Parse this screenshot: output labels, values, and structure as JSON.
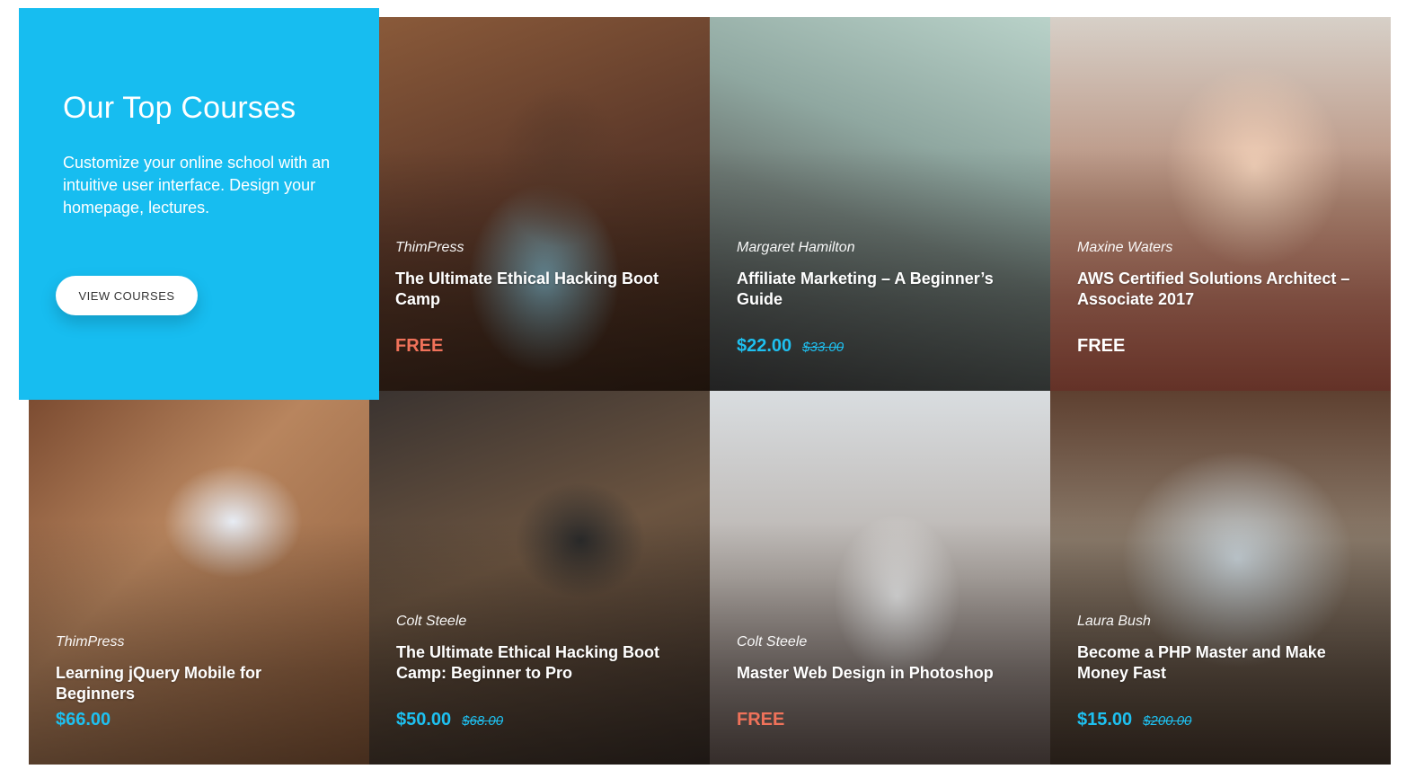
{
  "hero": {
    "title": "Our Top Courses",
    "description": "Customize your online school with an intuitive user interface. Design your homepage, lectures.",
    "button_label": "VIEW COURSES"
  },
  "courses": [
    {
      "author": "ThimPress",
      "title": "The Ultimate Ethical Hacking Boot Camp",
      "price": "FREE",
      "old_price": ""
    },
    {
      "author": "Margaret Hamilton",
      "title": "Affiliate Marketing – A Beginner’s Guide",
      "price": "$22.00",
      "old_price": "$33.00"
    },
    {
      "author": "Maxine Waters",
      "title": "AWS Certified Solutions Architect – Associate 2017",
      "price": "FREE",
      "old_price": ""
    },
    {
      "author": "ThimPress",
      "title": "Learning jQuery Mobile for Beginners",
      "price": "$66.00",
      "old_price": ""
    },
    {
      "author": "Colt Steele",
      "title": "The Ultimate Ethical Hacking Boot Camp: Beginner to Pro",
      "price": "$50.00",
      "old_price": "$68.00"
    },
    {
      "author": "Colt Steele",
      "title": "Master Web Design in Photoshop",
      "price": "FREE",
      "old_price": ""
    },
    {
      "author": "Laura Bush",
      "title": "Become a PHP Master and Make Money Fast",
      "price": "$15.00",
      "old_price": "$200.00"
    }
  ],
  "colors": {
    "accent": "#17bdf0",
    "price_blue": "#1ec0f0",
    "free_orange": "#f0725a"
  }
}
